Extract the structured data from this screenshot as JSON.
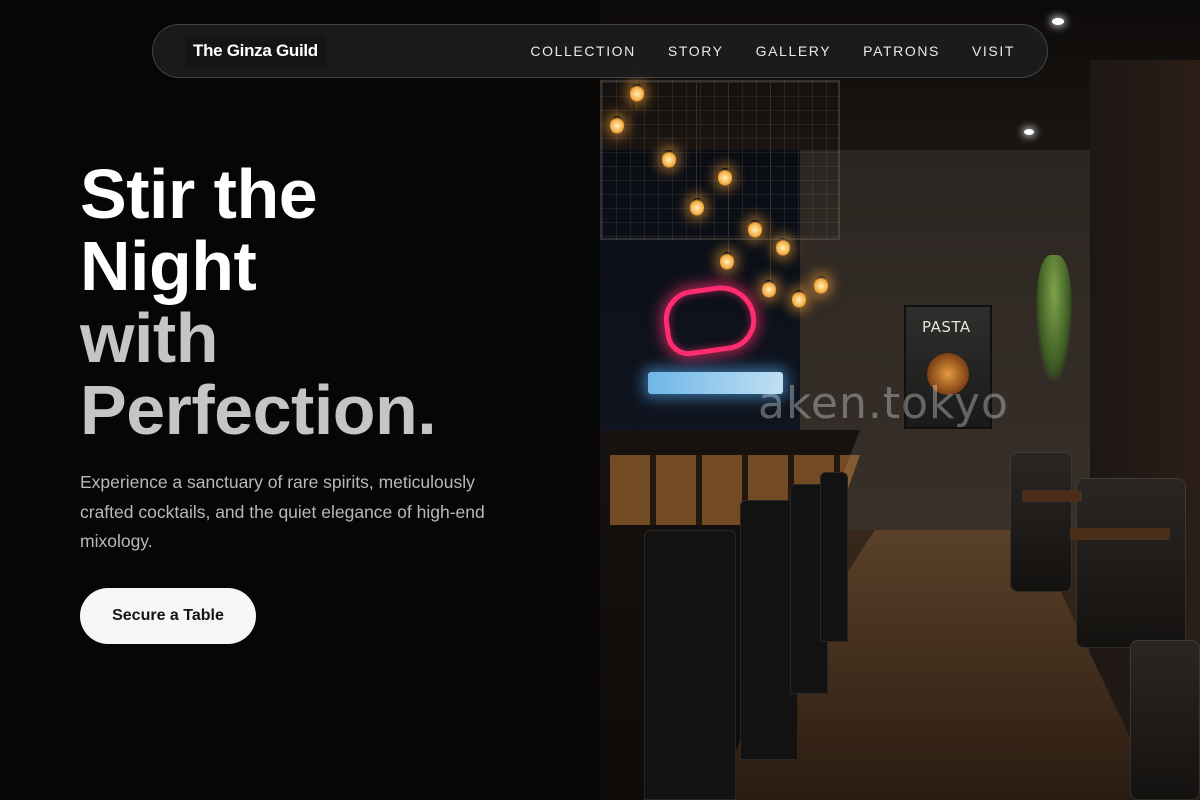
{
  "nav": {
    "brand": "The Ginza Guild",
    "links": [
      "COLLECTION",
      "STORY",
      "GALLERY",
      "PATRONS",
      "VISIT"
    ]
  },
  "hero": {
    "title_lines": [
      "Stir the",
      "Night"
    ],
    "title_accent_lines": [
      "with",
      "Perfection."
    ],
    "subtitle": "Experience a sanctuary of rare spirits, meticulously crafted cocktails, and the quiet elegance of high-end mixology.",
    "cta_label": "Secure a Table"
  },
  "photo": {
    "watermark": "aken.tokyo",
    "poster_word": "PASTA"
  },
  "colors": {
    "background": "#060606",
    "title_primary": "#ffffff",
    "title_accent": "#c5c5c5",
    "subtitle": "#b9b9b9",
    "cta_background": "#f6f6f8",
    "cta_text": "#151515",
    "neon_pink": "#ff2d6f"
  }
}
